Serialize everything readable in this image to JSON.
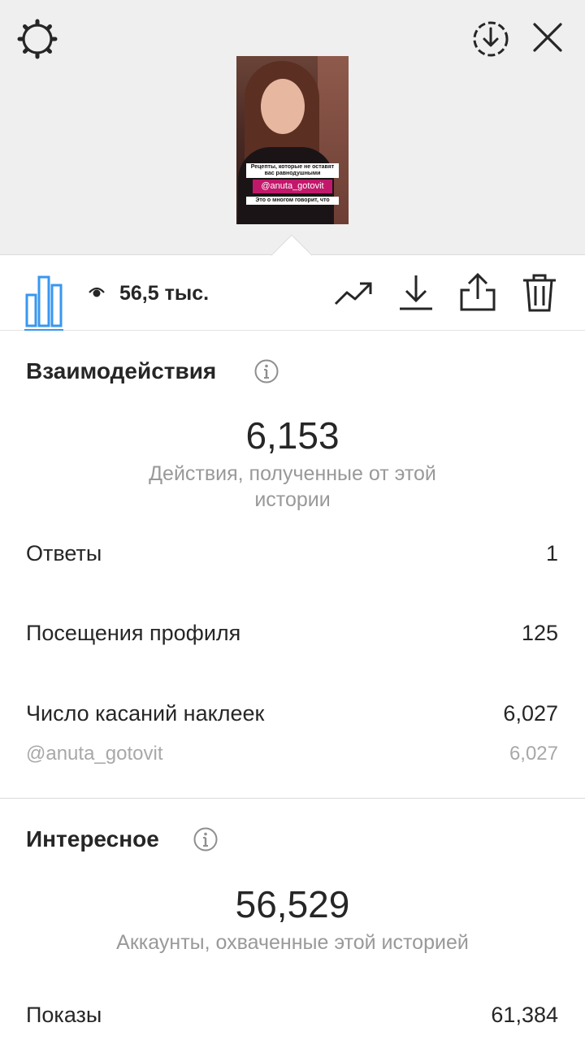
{
  "header": {
    "settings_icon": "gear-icon",
    "save_icon": "circle-download-icon",
    "close_icon": "close-icon"
  },
  "story_thumbnail": {
    "caption_top": "Рецепты, которые не оставят вас равнодушными",
    "mention_sticker": "@anuta_gotovit",
    "caption_bottom": "Это о многом говорит, что"
  },
  "toolbar": {
    "views_count": "56,5 тыс.",
    "icons": [
      "bar-chart-icon",
      "eye-icon",
      "trend-icon",
      "download-icon",
      "share-icon",
      "trash-icon"
    ],
    "accent_color": "#3897f0"
  },
  "interactions": {
    "title": "Взаимодействия",
    "total": "6,153",
    "total_caption": "Действия, полученные от этой истории",
    "rows": [
      {
        "label": "Ответы",
        "value": "1"
      },
      {
        "label": "Посещения профиля",
        "value": "125"
      },
      {
        "label": "Число касаний наклеек",
        "value": "6,027"
      }
    ],
    "sub_row": {
      "label": "@anuta_gotovit",
      "value": "6,027"
    }
  },
  "discovery": {
    "title": "Интересное",
    "total": "56,529",
    "total_caption": "Аккаунты, охваченные этой историей",
    "rows": [
      {
        "label": "Показы",
        "value": "61,384"
      }
    ]
  }
}
